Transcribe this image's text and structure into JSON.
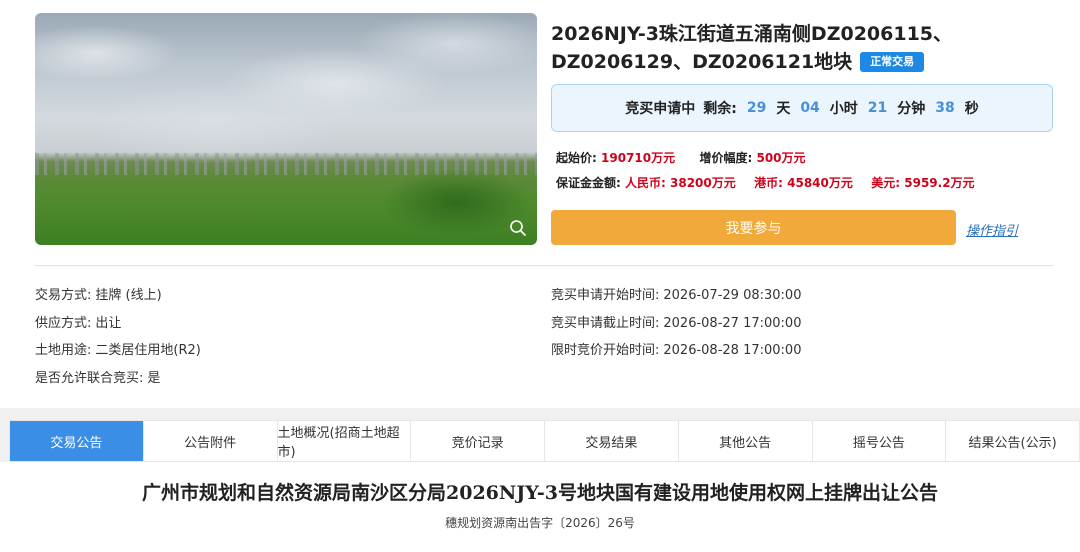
{
  "listing": {
    "title": "2026NJY-3珠江街道五涌南侧DZ0206115、DZ0206129、DZ0206121地块",
    "badge": "正常交易",
    "countdown": {
      "status": "竞买申请中",
      "remaining_label": "剩余:",
      "days": "29",
      "days_unit": "天",
      "hours": "04",
      "hours_unit": "小时",
      "minutes": "21",
      "minutes_unit": "分钟",
      "seconds": "38",
      "seconds_unit": "秒"
    },
    "start_price_label": "起始价:",
    "start_price": "190710万元",
    "increment_label": "增价幅度:",
    "increment": "500万元",
    "deposit_label": "保证金金额:",
    "deposit_rmb_label": "人民币:",
    "deposit_rmb": "38200万元",
    "deposit_hkd_label": "港币:",
    "deposit_hkd": "45840万元",
    "deposit_usd_label": "美元:",
    "deposit_usd": "5959.2万元",
    "join_button": "我要参与",
    "guide_link": "操作指引"
  },
  "details_left": [
    {
      "label": "交易方式:",
      "value": "挂牌 (线上)"
    },
    {
      "label": "供应方式:",
      "value": "出让"
    },
    {
      "label": "土地用途:",
      "value": "二类居住用地(R2)"
    },
    {
      "label": "是否允许联合竞买:",
      "value": "是"
    }
  ],
  "details_right": [
    {
      "label": "竞买申请开始时间:",
      "value": "2026-07-29 08:30:00"
    },
    {
      "label": "竞买申请截止时间:",
      "value": "2026-08-27 17:00:00"
    },
    {
      "label": "限时竞价开始时间:",
      "value": "2026-08-28 17:00:00"
    }
  ],
  "tabs": [
    "交易公告",
    "公告附件",
    "土地概况(招商土地超市)",
    "竞价记录",
    "交易结果",
    "其他公告",
    "摇号公告",
    "结果公告(公示)"
  ],
  "active_tab": 0,
  "notice": {
    "title": "广州市规划和自然资源局南沙区分局2026NJY-3号地块国有建设用地使用权网上挂牌出让公告",
    "doc_no": "穗规划资源南出告字〔2026〕26号"
  },
  "colors": {
    "accent_blue": "#3a8ee6",
    "badge_blue": "#1e88e5",
    "price_red": "#d0021b",
    "button_orange": "#f0a93a",
    "countdown_number": "#4a90d9"
  }
}
